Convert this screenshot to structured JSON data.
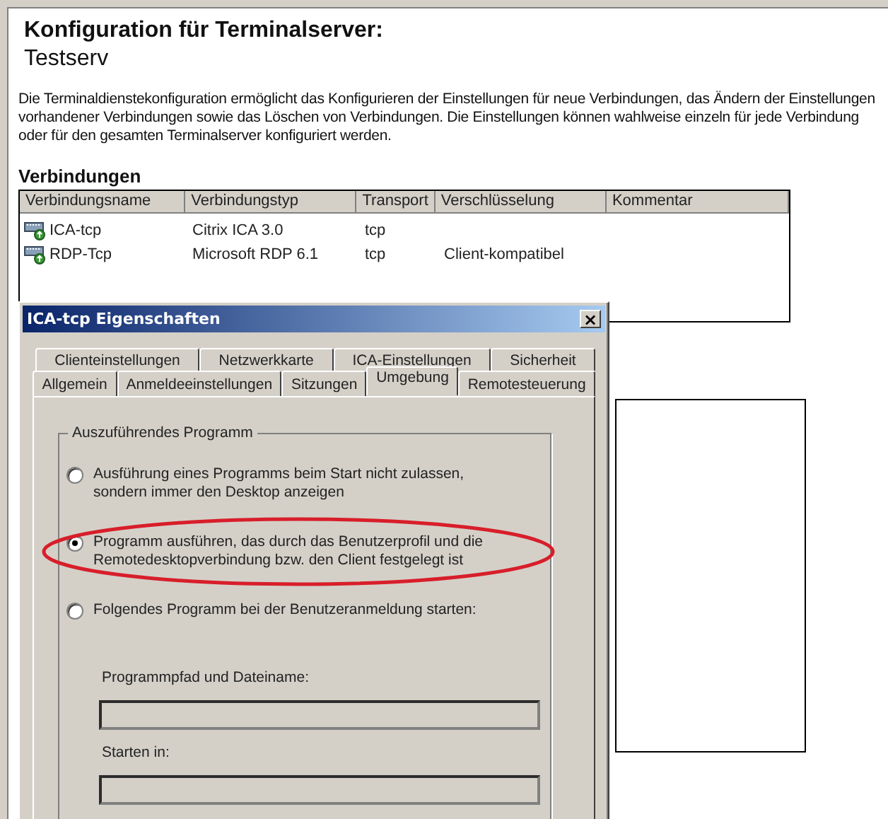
{
  "page": {
    "title": "Konfiguration für Terminalserver:",
    "subtitle": "Testserv",
    "description": "Die Terminaldienstekonfiguration ermöglicht das Konfigurieren der Einstellungen für neue Verbindungen, das Ändern der Einstellungen vorhandener Verbindungen sowie das Löschen von Verbindungen. Die Einstellungen können wahlweise einzeln für jede Verbindung oder für den gesamten Terminalserver konfiguriert werden.",
    "section": "Verbindungen"
  },
  "table": {
    "columns": [
      "Verbindungsname",
      "Verbindungstyp",
      "Transport",
      "Verschlüsselung",
      "Kommentar"
    ],
    "rows": [
      {
        "name": "ICA-tcp",
        "type": "Citrix ICA 3.0",
        "transport": "tcp",
        "encryption": ""
      },
      {
        "name": "RDP-Tcp",
        "type": "Microsoft RDP 6.1",
        "transport": "tcp",
        "encryption": "Client-kompatibel"
      }
    ]
  },
  "dialog": {
    "title": "ICA-tcp Eigenschaften",
    "close": "×",
    "tab_rows": [
      {
        "tabs": [
          {
            "label": "Clienteinstellungen",
            "selected": false
          },
          {
            "label": "Netzwerkkarte",
            "selected": false
          },
          {
            "label": "ICA-Einstellungen",
            "selected": false
          },
          {
            "label": "Sicherheit",
            "selected": false
          }
        ]
      },
      {
        "tabs": [
          {
            "label": "Allgemein",
            "selected": false
          },
          {
            "label": "Anmeldeeinstellungen",
            "selected": false
          },
          {
            "label": "Sitzungen",
            "selected": false
          },
          {
            "label": "Umgebung",
            "selected": true
          },
          {
            "label": "Remotesteuerung",
            "selected": false
          }
        ]
      }
    ],
    "group": {
      "legend": "Auszuführendes Programm",
      "options": [
        {
          "label": "Ausführung eines Programms beim Start nicht zulassen, sondern immer den Desktop anzeigen",
          "selected": false,
          "highlighted": false
        },
        {
          "label": "Programm ausführen, das durch das Benutzerprofil und die Remotedesktopverbindung bzw. den Client festgelegt ist",
          "selected": true,
          "highlighted": true
        },
        {
          "label": "Folgendes Programm bei der Benutzeranmeldung starten:",
          "selected": false,
          "highlighted": false
        }
      ],
      "fields": [
        {
          "label": "Programmpfad und Dateiname:",
          "disabled": true
        },
        {
          "label": "Starten in:",
          "disabled": true
        }
      ]
    }
  }
}
